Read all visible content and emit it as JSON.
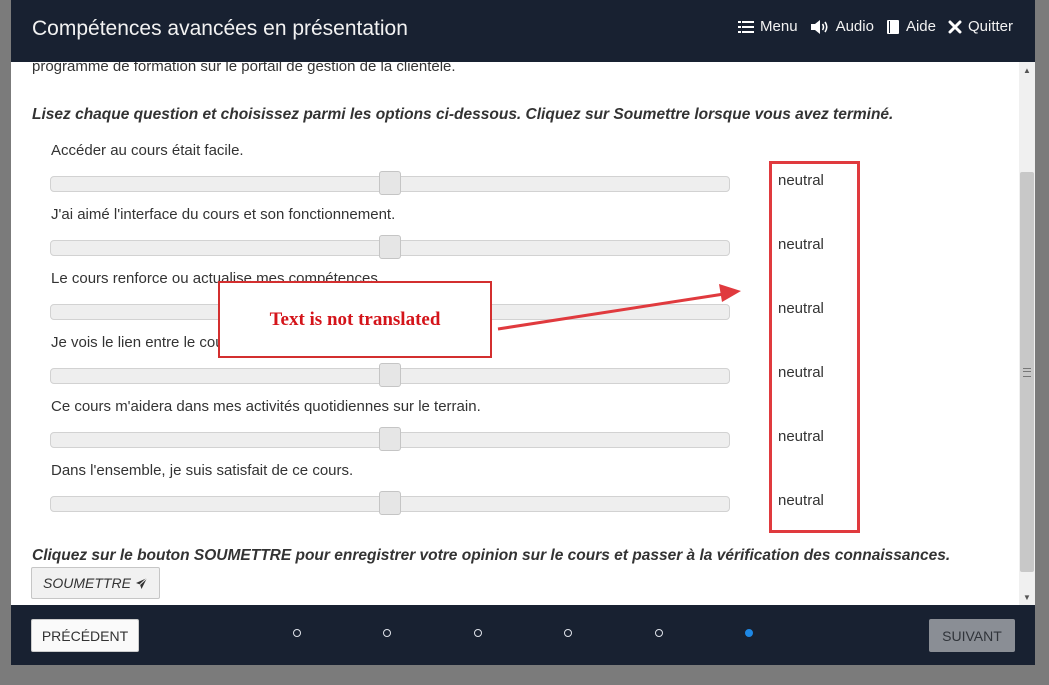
{
  "header": {
    "title": "Compétences avancées en présentation",
    "nav": {
      "menu": "Menu",
      "audio": "Audio",
      "help": "Aide",
      "quit": "Quitter"
    }
  },
  "content": {
    "intro_partial": "programme de formation sur le portail de gestion de la clientèle.",
    "instructions": "Lisez chaque question et choisissez parmi les options ci-dessous. Cliquez sur Soumettre lorsque vous avez terminé.",
    "questions": [
      {
        "text": "Accéder au cours était facile.",
        "value_label": "neutral",
        "slider_value": 0.5
      },
      {
        "text": "J'ai aimé l'interface du cours et son fonctionnement.",
        "value_label": "neutral",
        "slider_value": 0.5
      },
      {
        "text": "Le cours renforce ou actualise mes compétences.",
        "value_label": "neutral",
        "slider_value": 0.5
      },
      {
        "text": "Je vois le lien entre le cours et les objectifs de mon entreprise.",
        "value_label": "neutral",
        "slider_value": 0.5
      },
      {
        "text": "Ce cours m'aidera dans mes activités quotidiennes sur le terrain.",
        "value_label": "neutral",
        "slider_value": 0.5
      },
      {
        "text": "Dans l'ensemble, je suis satisfait de ce cours.",
        "value_label": "neutral",
        "slider_value": 0.5
      }
    ],
    "submit_note": "Cliquez sur le bouton SOUMETTRE pour enregistrer votre opinion sur le cours et passer à la vérification des connaissances.",
    "submit_label": "SOUMETTRE"
  },
  "footer": {
    "prev_label": "PRÉCÉDENT",
    "next_label": "SUIVANT",
    "dots_total": 6,
    "dots_active_index": 5
  },
  "annotation": {
    "callout_text": "Text is not translated",
    "color": "#e03a3e"
  },
  "colors": {
    "header_bg": "#182131",
    "accent": "#1e88e5"
  }
}
